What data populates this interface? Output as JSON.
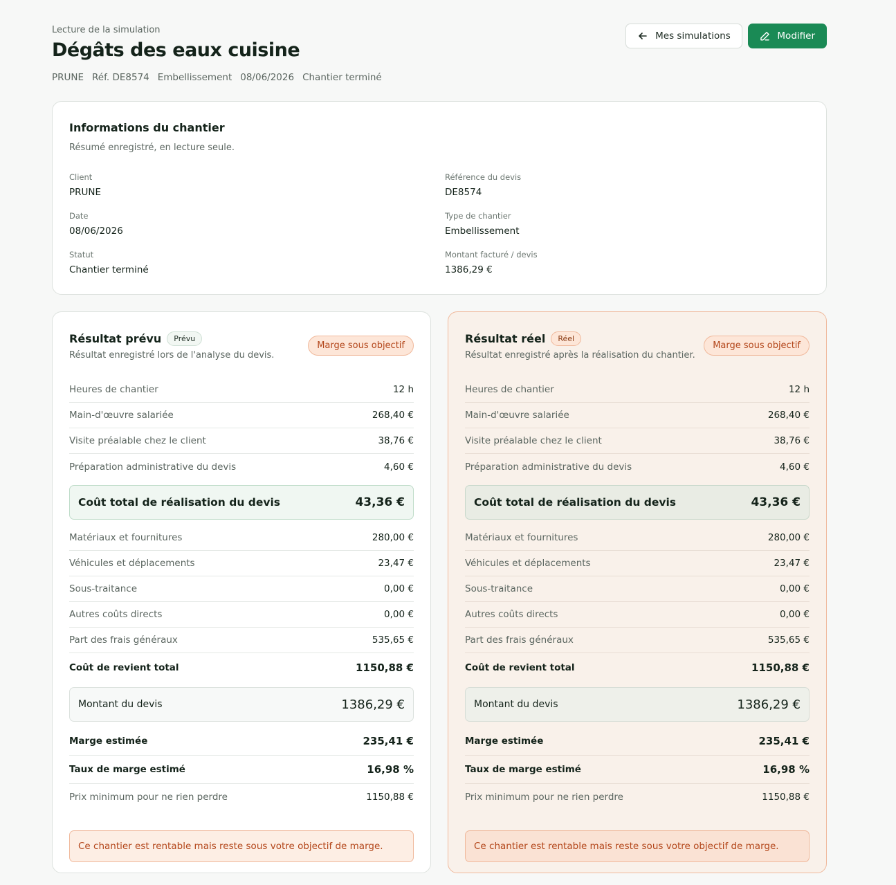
{
  "header": {
    "eyebrow": "Lecture de la simulation",
    "title": "Dégâts des eaux cuisine",
    "meta": [
      "PRUNE",
      "Réf. DE8574",
      "Embellissement",
      "08/06/2026",
      "Chantier terminé"
    ]
  },
  "actions": {
    "back_label": "Mes simulations",
    "edit_label": "Modifier"
  },
  "info": {
    "title": "Informations du chantier",
    "subtitle": "Résumé enregistré, en lecture seule.",
    "fields": [
      {
        "label": "Client",
        "value": "PRUNE"
      },
      {
        "label": "Référence du devis",
        "value": "DE8574"
      },
      {
        "label": "Date",
        "value": "08/06/2026"
      },
      {
        "label": "Type de chantier",
        "value": "Embellissement"
      },
      {
        "label": "Statut",
        "value": "Chantier terminé"
      },
      {
        "label": "Montant facturé / devis",
        "value": "1386,29 €"
      }
    ]
  },
  "planned": {
    "title": "Résultat prévu",
    "tag": "Prévu",
    "subtitle": "Résultat enregistré lors de l'analyse du devis.",
    "badge": "Marge sous objectif",
    "rows_a": [
      {
        "label": "Heures de chantier",
        "value": "12 h"
      },
      {
        "label": "Main-d'œuvre salariée",
        "value": "268,40 €"
      },
      {
        "label": "Visite préalable chez le client",
        "value": "38,76 €"
      },
      {
        "label": "Préparation administrative du devis",
        "value": "4,60 €"
      }
    ],
    "highlight": {
      "label": "Coût total de réalisation du devis",
      "value": "43,36 €"
    },
    "rows_b": [
      {
        "label": "Matériaux et fournitures",
        "value": "280,00 €"
      },
      {
        "label": "Véhicules et déplacements",
        "value": "23,47 €"
      },
      {
        "label": "Sous-traitance",
        "value": "0,00 €"
      },
      {
        "label": "Autres coûts directs",
        "value": "0,00 €"
      },
      {
        "label": "Part des frais généraux",
        "value": "535,65 €"
      }
    ],
    "cost_total": {
      "label": "Coût de revient total",
      "value": "1150,88 €"
    },
    "amount": {
      "label": "Montant du devis",
      "value": "1386,29 €"
    },
    "margin": {
      "label": "Marge estimée",
      "value": "235,41 €"
    },
    "margin_rate": {
      "label": "Taux de marge estimé",
      "value": "16,98 %"
    },
    "min_price": {
      "label": "Prix minimum pour ne rien perdre",
      "value": "1150,88 €"
    },
    "alert": "Ce chantier est rentable mais reste sous votre objectif de marge."
  },
  "real": {
    "title": "Résultat réel",
    "tag": "Réel",
    "subtitle": "Résultat enregistré après la réalisation du chantier.",
    "badge": "Marge sous objectif",
    "rows_a": [
      {
        "label": "Heures de chantier",
        "value": "12 h"
      },
      {
        "label": "Main-d'œuvre salariée",
        "value": "268,40 €"
      },
      {
        "label": "Visite préalable chez le client",
        "value": "38,76 €"
      },
      {
        "label": "Préparation administrative du devis",
        "value": "4,60 €"
      }
    ],
    "highlight": {
      "label": "Coût total de réalisation du devis",
      "value": "43,36 €"
    },
    "rows_b": [
      {
        "label": "Matériaux et fournitures",
        "value": "280,00 €"
      },
      {
        "label": "Véhicules et déplacements",
        "value": "23,47 €"
      },
      {
        "label": "Sous-traitance",
        "value": "0,00 €"
      },
      {
        "label": "Autres coûts directs",
        "value": "0,00 €"
      },
      {
        "label": "Part des frais généraux",
        "value": "535,65 €"
      }
    ],
    "cost_total": {
      "label": "Coût de revient total",
      "value": "1150,88 €"
    },
    "amount": {
      "label": "Montant du devis",
      "value": "1386,29 €"
    },
    "margin": {
      "label": "Marge estimée",
      "value": "235,41 €"
    },
    "margin_rate": {
      "label": "Taux de marge estimé",
      "value": "16,98 %"
    },
    "min_price": {
      "label": "Prix minimum pour ne rien perdre",
      "value": "1150,88 €"
    },
    "alert": "Ce chantier est rentable mais reste sous votre objectif de marge."
  },
  "icons": {
    "back": "arrow-left-icon",
    "edit": "pencil-icon"
  },
  "colors": {
    "primary": "#1a8a55",
    "warning": "#b3461a",
    "warning_bg": "#fde6d8"
  }
}
